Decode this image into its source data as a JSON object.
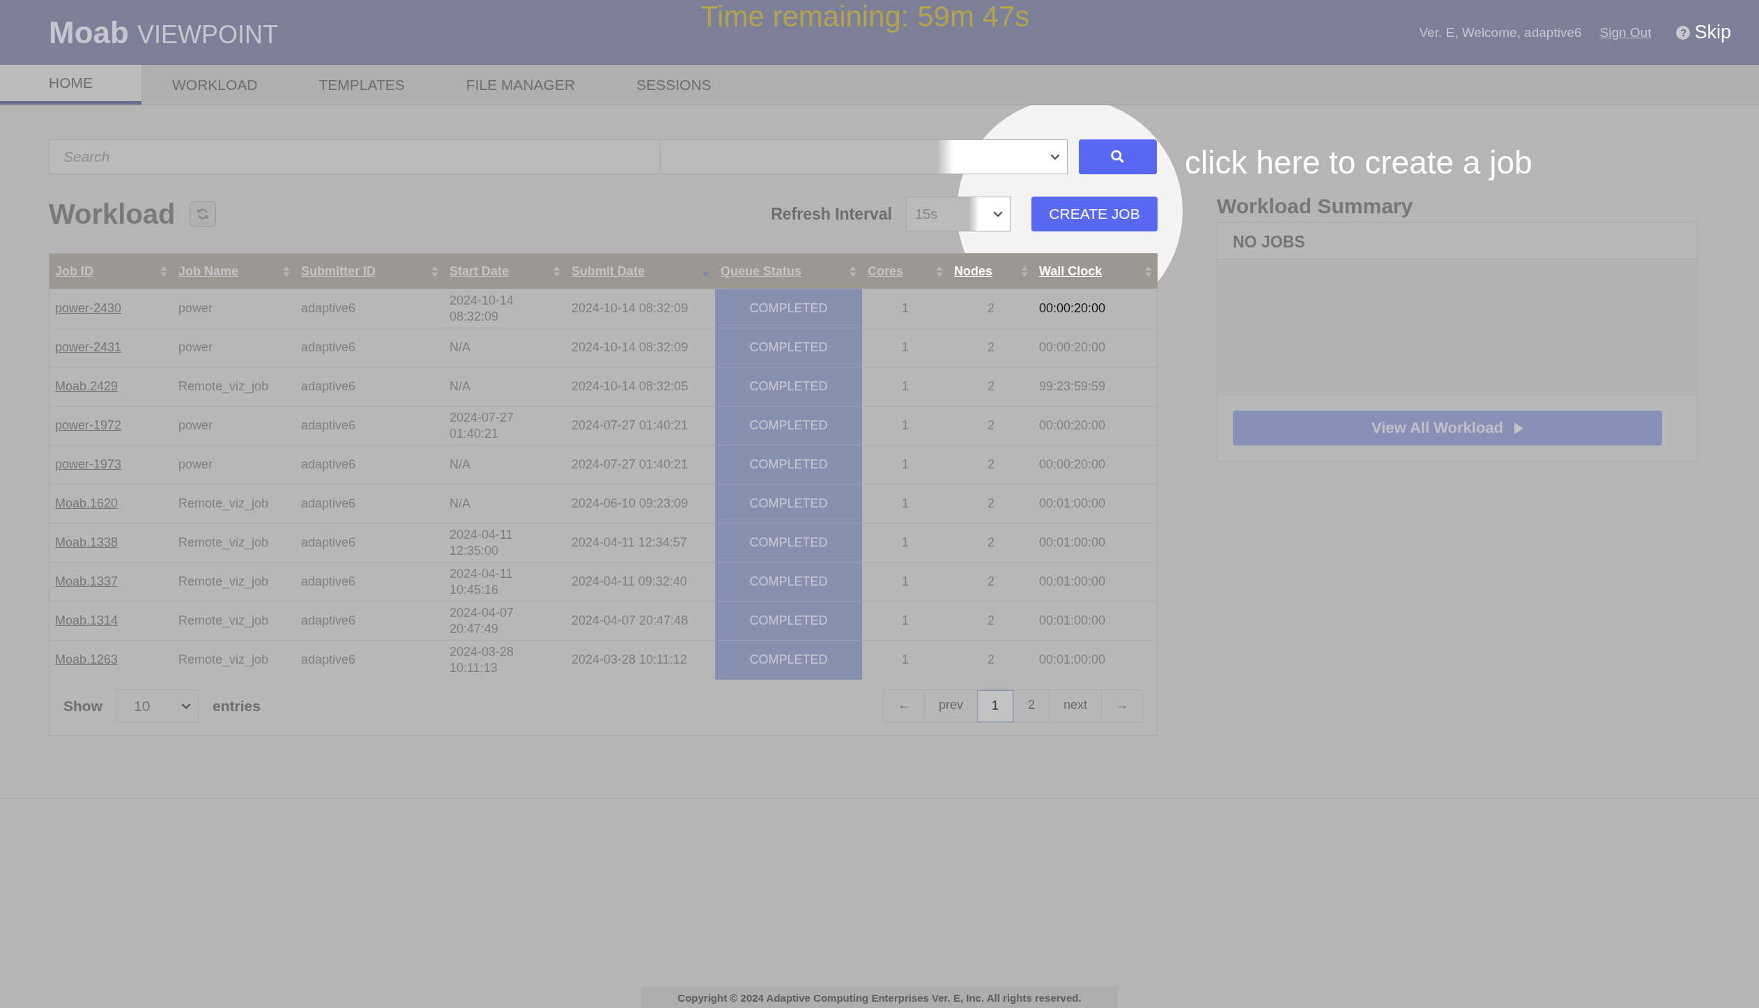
{
  "header": {
    "logo_bold": "Moab",
    "logo_light": "VIEWPOINT",
    "timer": "Time remaining: 59m 47s",
    "welcome": "Ver. E, Welcome, adaptive6",
    "sign_out": "Sign Out",
    "help": "?",
    "skip": "Skip"
  },
  "tabs": [
    {
      "label": "HOME",
      "selected": true
    },
    {
      "label": "WORKLOAD",
      "selected": false
    },
    {
      "label": "TEMPLATES",
      "selected": false
    },
    {
      "label": "FILE MANAGER",
      "selected": false
    },
    {
      "label": "SESSIONS",
      "selected": false
    }
  ],
  "search": {
    "placeholder": "Search"
  },
  "workload": {
    "title": "Workload",
    "refresh_label": "Refresh Interval",
    "refresh_value": "15s",
    "create_button": "CREATE JOB"
  },
  "table": {
    "columns": [
      {
        "label": "Job ID",
        "sorted": false
      },
      {
        "label": "Job Name",
        "sorted": false
      },
      {
        "label": "Submitter ID",
        "sorted": false
      },
      {
        "label": "Start Date",
        "sorted": false
      },
      {
        "label": "Submit Date",
        "sorted": true
      },
      {
        "label": "Queue Status",
        "sorted": false
      },
      {
        "label": "Cores",
        "sorted": false
      },
      {
        "label": "Nodes",
        "sorted": false
      },
      {
        "label": "Wall Clock",
        "sorted": false
      }
    ],
    "rows": [
      [
        "power-2430",
        "power",
        "adaptive6",
        "2024-10-14 08:32:09",
        "2024-10-14 08:32:09",
        "COMPLETED",
        "1",
        "2",
        "00:00:20:00"
      ],
      [
        "power-2431",
        "power",
        "adaptive6",
        "N/A",
        "2024-10-14 08:32:09",
        "COMPLETED",
        "1",
        "2",
        "00:00:20:00"
      ],
      [
        "Moab.2429",
        "Remote_viz_job",
        "adaptive6",
        "N/A",
        "2024-10-14 08:32:05",
        "COMPLETED",
        "1",
        "2",
        "99:23:59:59"
      ],
      [
        "power-1972",
        "power",
        "adaptive6",
        "2024-07-27 01:40:21",
        "2024-07-27 01:40:21",
        "COMPLETED",
        "1",
        "2",
        "00:00:20:00"
      ],
      [
        "power-1973",
        "power",
        "adaptive6",
        "N/A",
        "2024-07-27 01:40:21",
        "COMPLETED",
        "1",
        "2",
        "00:00:20:00"
      ],
      [
        "Moab.1620",
        "Remote_viz_job",
        "adaptive6",
        "N/A",
        "2024-06-10 09:23:09",
        "COMPLETED",
        "1",
        "2",
        "00:01:00:00"
      ],
      [
        "Moab.1338",
        "Remote_viz_job",
        "adaptive6",
        "2024-04-11 12:35:00",
        "2024-04-11 12:34:57",
        "COMPLETED",
        "1",
        "2",
        "00:01:00:00"
      ],
      [
        "Moab.1337",
        "Remote_viz_job",
        "adaptive6",
        "2024-04-11 10:45:16",
        "2024-04-11 09:32:40",
        "COMPLETED",
        "1",
        "2",
        "00:01:00:00"
      ],
      [
        "Moab.1314",
        "Remote_viz_job",
        "adaptive6",
        "2024-04-07 20:47:49",
        "2024-04-07 20:47:48",
        "COMPLETED",
        "1",
        "2",
        "00:01:00:00"
      ],
      [
        "Moab.1263",
        "Remote_viz_job",
        "adaptive6",
        "2024-03-28 10:11:13",
        "2024-03-28 10:11:12",
        "COMPLETED",
        "1",
        "2",
        "00:01:00:00"
      ]
    ]
  },
  "entries": {
    "show": "Show",
    "value": "10",
    "suffix": "entries"
  },
  "pagination": [
    {
      "label": "←",
      "selected": false
    },
    {
      "label": "prev",
      "selected": false
    },
    {
      "label": "1",
      "selected": true
    },
    {
      "label": "2",
      "selected": false
    },
    {
      "label": "next",
      "selected": false
    },
    {
      "label": "→",
      "selected": false
    }
  ],
  "summary": {
    "title": "Workload Summary",
    "empty": "NO JOBS",
    "button": "View All Workload"
  },
  "tooltip": "click here to create a job",
  "footer": "Copyright © 2024 Adaptive Computing Enterprises Ver. E, Inc. All rights reserved."
}
